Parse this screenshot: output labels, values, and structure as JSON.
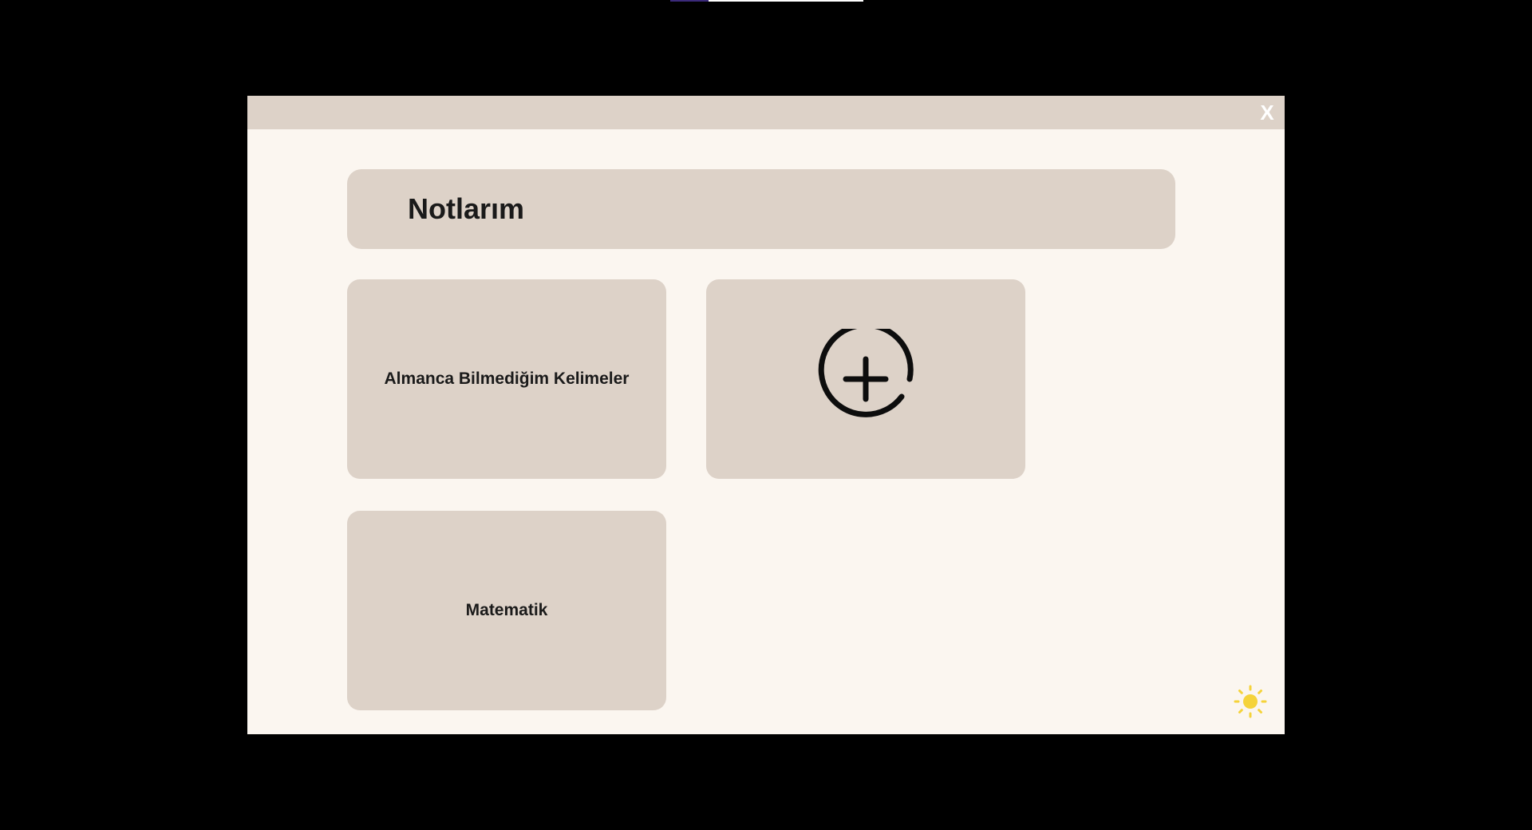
{
  "modal": {
    "close_label": "X",
    "title": "Notlarım"
  },
  "notes": [
    {
      "label": "Almanca Bilmediğim Kelimeler"
    },
    {
      "label": "Matematik"
    }
  ],
  "add_note": {
    "icon": "plus-circle-icon"
  },
  "theme_toggle": {
    "icon": "sun-icon",
    "color": "#f5d33a"
  },
  "colors": {
    "backdrop": "#000000",
    "modal_bg": "#fbf6f0",
    "panel_bg": "#ddd2c8",
    "text": "#1a1a1a"
  }
}
